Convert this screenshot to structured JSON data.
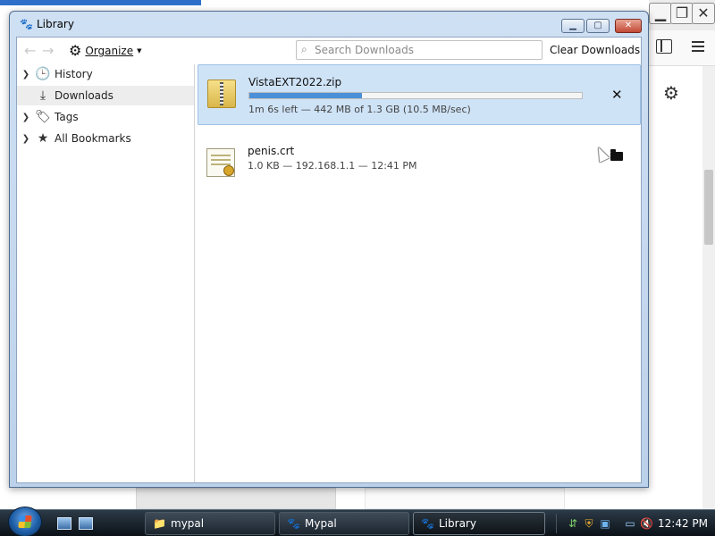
{
  "window": {
    "title": "Library",
    "minimize_glyph": "▁",
    "maximize_glyph": "▢",
    "close_glyph": "✕"
  },
  "toolbar": {
    "back_glyph": "←",
    "forward_glyph": "→",
    "organize_label": "Organize",
    "organize_icon": "gear-icon",
    "search_placeholder": "Search Downloads",
    "clear_label": "Clear Downloads"
  },
  "sidebar": {
    "items": [
      {
        "label": "History",
        "icon": "clock-icon",
        "selected": false
      },
      {
        "label": "Downloads",
        "icon": "download-icon",
        "selected": true
      },
      {
        "label": "Tags",
        "icon": "tag-icon",
        "selected": false
      },
      {
        "label": "All Bookmarks",
        "icon": "star-icon",
        "selected": false
      }
    ]
  },
  "downloads": [
    {
      "name": "VistaEXT2022.zip",
      "status": "1m 6s left — 442 MB of 1.3 GB (10.5 MB/sec)",
      "progress": 0.34,
      "state": "in-progress",
      "action": "cancel"
    },
    {
      "name": "penis.crt",
      "status": "1.0 KB — 192.168.1.1 — 12:41 PM",
      "state": "completed",
      "action": "open-folder"
    }
  ],
  "taskbar": {
    "buttons": [
      {
        "label": "mypal",
        "icon": "folder-icon"
      },
      {
        "label": "Mypal",
        "icon": "mypal-icon"
      },
      {
        "label": "Library",
        "icon": "mypal-icon",
        "active": true
      }
    ],
    "clock": "12:42 PM"
  },
  "colors": {
    "progress_fill": "#4a90d9",
    "selected_download_bg": "#cfe3f7",
    "taskbar": "#1a2430"
  }
}
